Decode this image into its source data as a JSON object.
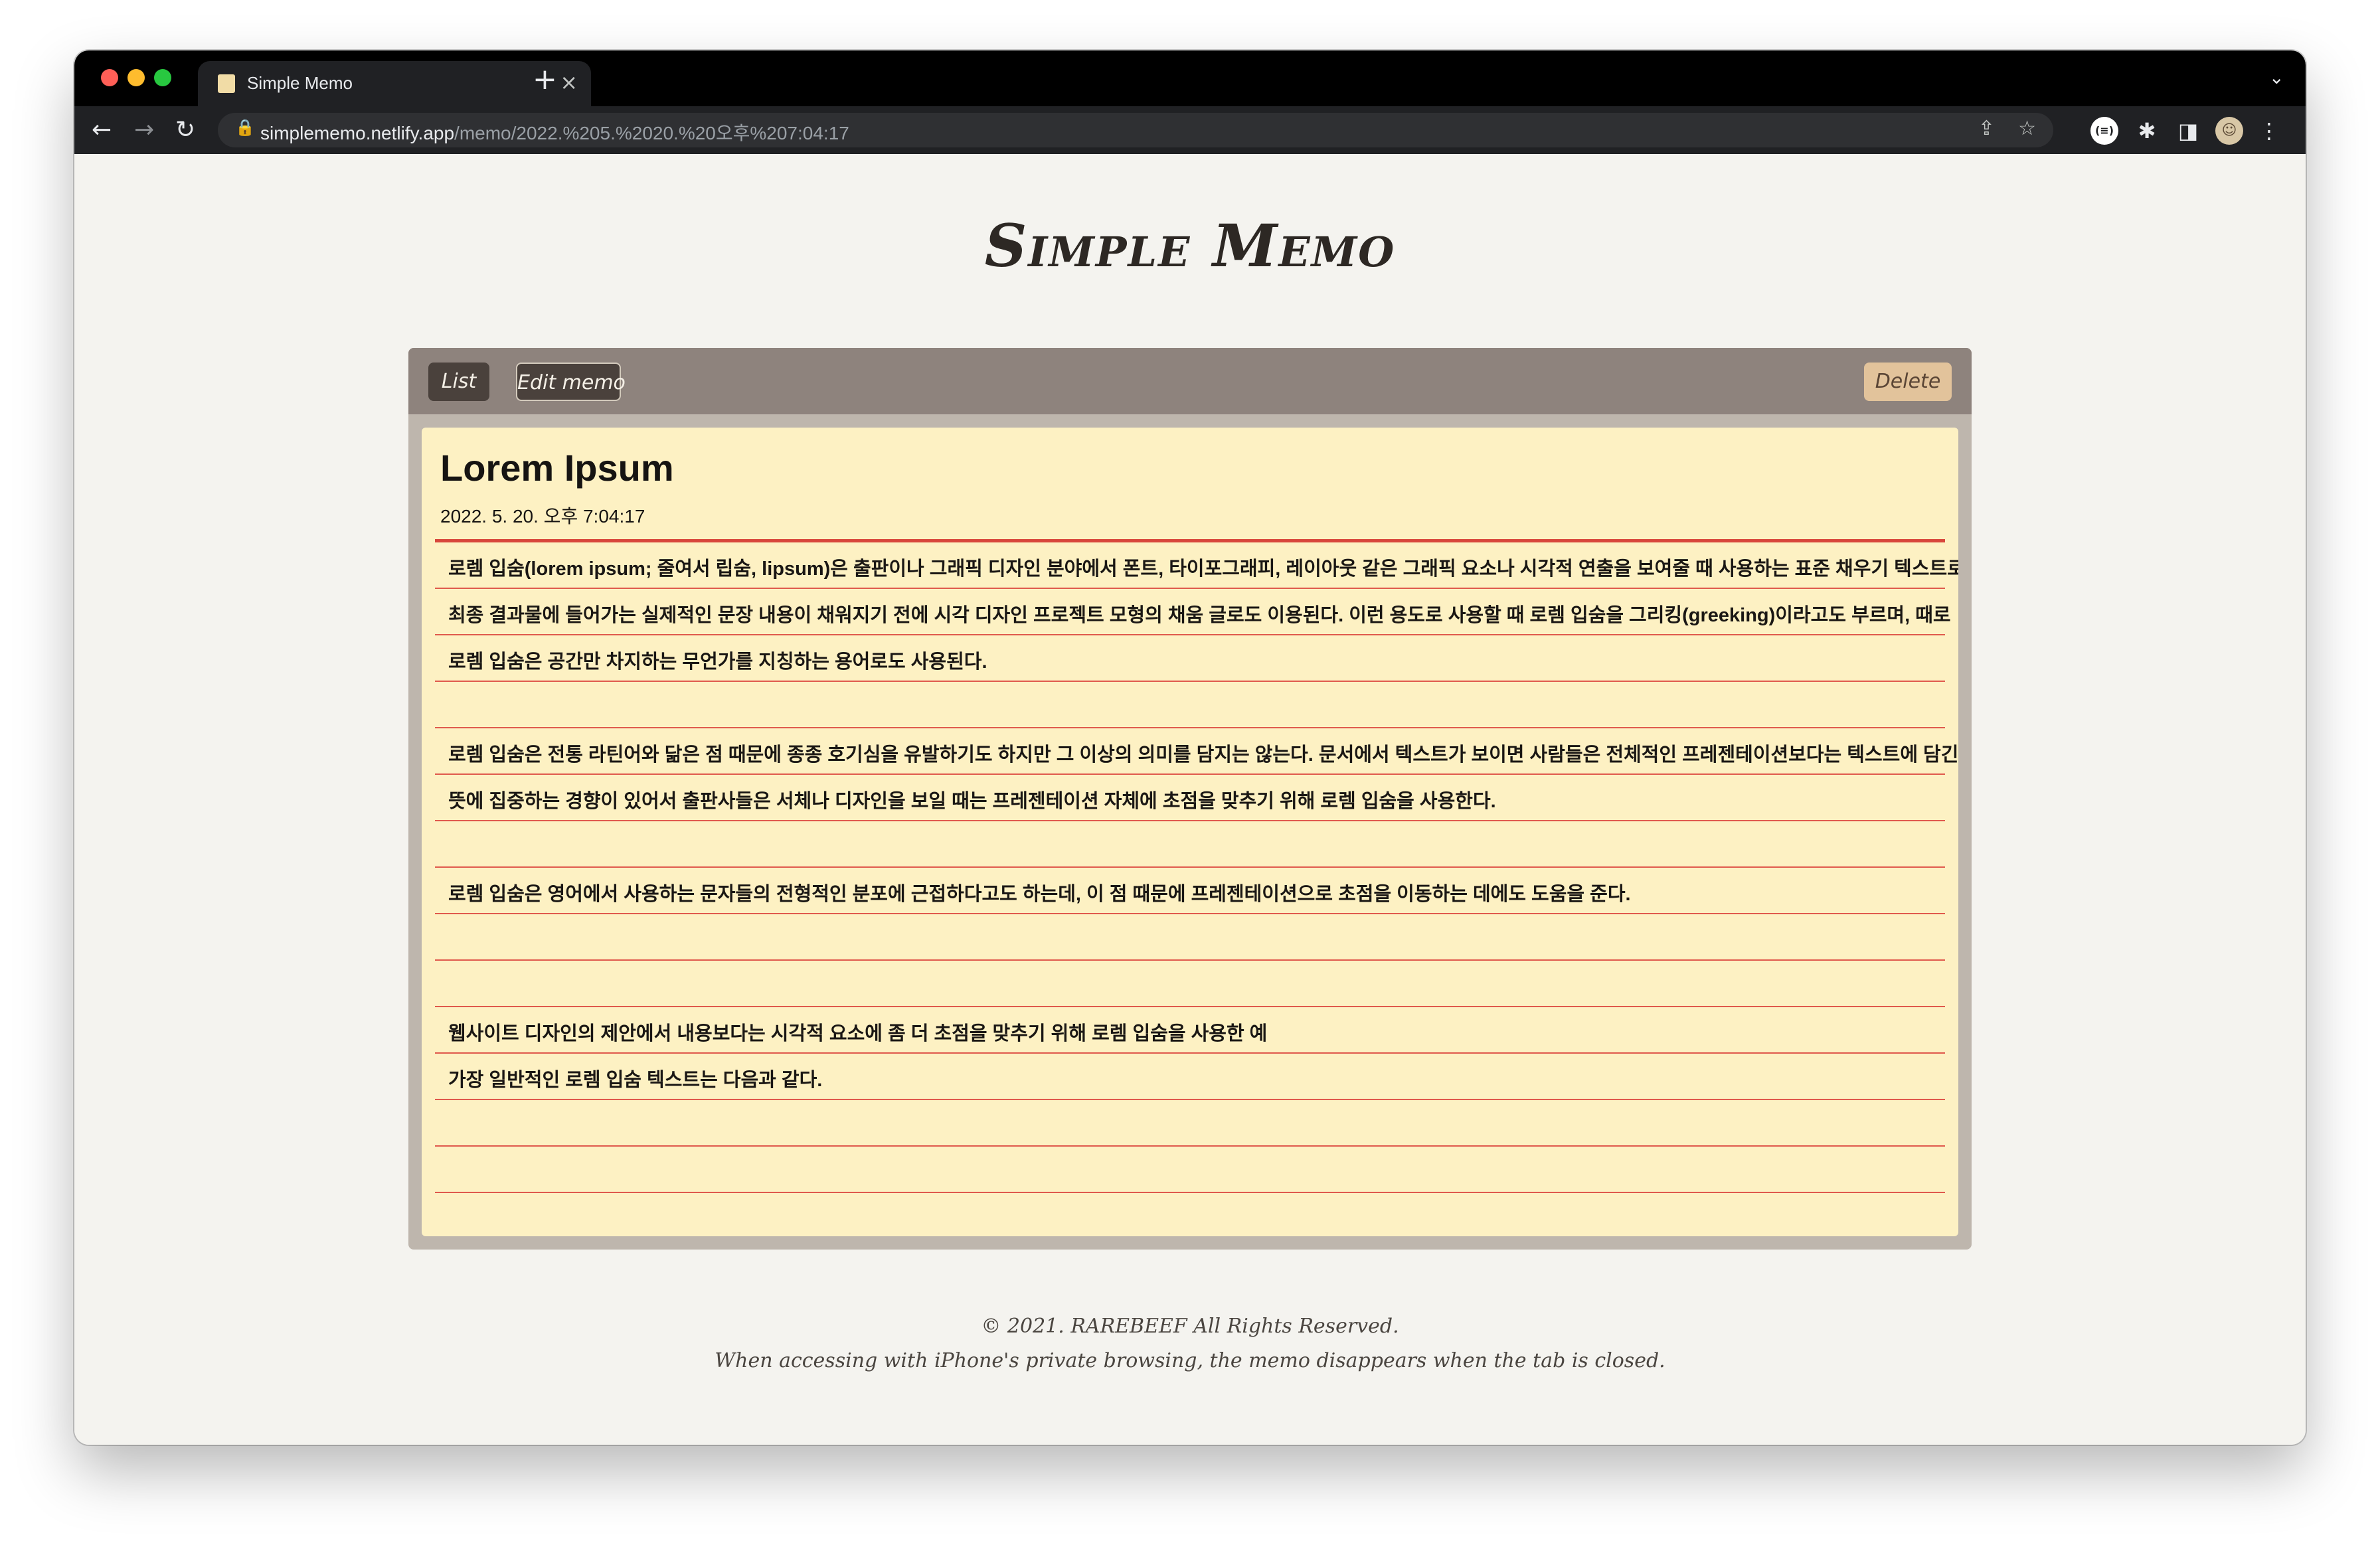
{
  "browser": {
    "tab_title": "Simple Memo",
    "tab_close": "×",
    "new_tab": "+",
    "tab_dropdown": "⌄",
    "url_host": "simplememo.netlify.app",
    "url_path": "/memo/2022.%205.%2020.%20오후%207:04:17",
    "icons": {
      "back": "←",
      "forward": "→",
      "reload": "↻",
      "lock": "🔒",
      "share": "⇪",
      "star": "☆",
      "custom_ext": "(≡)",
      "puzzle": "✱",
      "sidepanel": "◨",
      "avatar": "☺",
      "menu": "⋮"
    }
  },
  "site": {
    "title": "Simple Memo"
  },
  "toolbar": {
    "list_label": "List",
    "edit_label": "Edit memo",
    "delete_label": "Delete"
  },
  "memo": {
    "title": "Lorem Ipsum",
    "date": "2022. 5. 20. 오후 7:04:17",
    "lines": [
      "로렘 입숨(lorem ipsum; 줄여서 립숨, lipsum)은 출판이나 그래픽 디자인 분야에서 폰트, 타이포그래피, 레이아웃 같은 그래픽 요소나 시각적 연출을 보여줄 때 사용하는 표준 채우기 텍스트로,",
      "최종 결과물에 들어가는 실제적인 문장 내용이 채워지기 전에 시각 디자인 프로젝트 모형의 채움 글로도 이용된다. 이런 용도로 사용할 때 로렘 입숨을 그리킹(greeking)이라고도 부르며, 때로",
      "로렘 입숨은 공간만 차지하는 무언가를 지칭하는 용어로도 사용된다.",
      "",
      "로렘 입숨은 전통 라틴어와 닮은 점 때문에 종종 호기심을 유발하기도 하지만 그 이상의 의미를 담지는 않는다. 문서에서 텍스트가 보이면 사람들은 전체적인 프레젠테이션보다는 텍스트에 담긴",
      "뜻에 집중하는 경향이 있어서 출판사들은 서체나 디자인을 보일 때는 프레젠테이션 자체에 초점을 맞추기 위해 로렘 입숨을 사용한다.",
      "",
      "로렘 입숨은 영어에서 사용하는 문자들의 전형적인 분포에 근접하다고도 하는데, 이 점 때문에 프레젠테이션으로 초점을 이동하는 데에도 도움을 준다.",
      "",
      "",
      "웹사이트 디자인의 제안에서 내용보다는 시각적 요소에 좀 더 초점을 맞추기 위해 로렘 입숨을 사용한 예",
      "가장 일반적인 로렘 입숨 텍스트는 다음과 같다.",
      "",
      "",
      ""
    ]
  },
  "footer": {
    "copyright": "© 2021. RAREBEEF All Rights Reserved.",
    "note": "When accessing with iPhone's private browsing, the memo disappears when the tab is closed."
  },
  "colors": {
    "page_bg": "#f4f3ef",
    "panel_header": "#8e837d",
    "panel_body": "#beb6ad",
    "memo_bg": "#fdf1c3",
    "rule_line": "#e05a4d",
    "button_dark": "#4a413c",
    "button_delete": "#e2c39b"
  }
}
